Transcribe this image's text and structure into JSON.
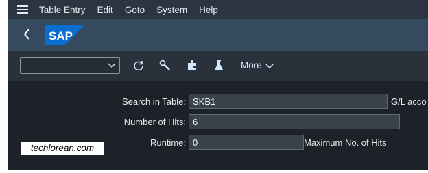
{
  "menubar": {
    "items": [
      {
        "label": "Table Entry"
      },
      {
        "label": "Edit"
      },
      {
        "label": "Goto"
      },
      {
        "label": "System"
      },
      {
        "label": "Help"
      }
    ]
  },
  "shellbar": {
    "logo_text": "SAP",
    "brand_color": "#0a6ed1"
  },
  "toolbar": {
    "select_value": "",
    "icons": [
      "refresh-icon",
      "wrench-icon",
      "puzzle-icon",
      "flask-icon"
    ],
    "more_label": "More"
  },
  "form": {
    "search_label": "Search in Table:",
    "search_value": "SKB1",
    "search_desc": "G/L acco",
    "hits_label": "Number of Hits:",
    "hits_value": "6",
    "runtime_label": "Runtime:",
    "runtime_value": "0",
    "max_hits_label": "Maximum No. of Hits"
  },
  "watermark": "techlorean.com"
}
